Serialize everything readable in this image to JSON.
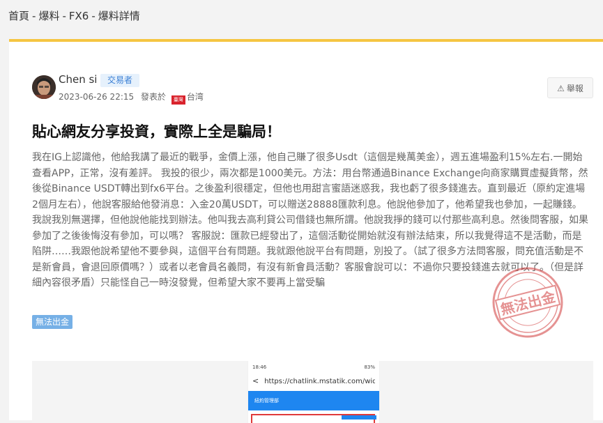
{
  "breadcrumb": {
    "items": [
      "首頁",
      "爆料",
      "FX6",
      "爆料詳情"
    ],
    "separator": "-"
  },
  "post": {
    "author": "Chen si",
    "role": "交易者",
    "datetime": "2023-06-26 22:15",
    "posted_in_label": "發表於",
    "flag_text": "臺灣",
    "region": "台湾",
    "report_label": "舉報",
    "title": "貼心網友分享投資，實際上全是騙局！",
    "body": "我在IG上認識他，他給我講了最近的戰爭，金價上漲，他自己賺了很多Usdt（這個是幾萬美金），週五進場盈利15%左右.一開始查看APP，正常，沒有差評。 我投的很少，兩次都是1000美元。方法：用台幣通過Binance Exchange向商家購買虛擬貨幣，然後從Binance USDT轉出到fx6平台。之後盈利很穩定，但他也用甜言蜜語迷惑我，我也虧了很多錢進去。直到最近（原約定進場2個月左右），他說客服給他發消息：入金20萬USDT，可以贈送28888匯款利息。他說他參加了，他希望我也參加，一起賺錢。 我說我別無選擇，但他說他能找到辦法。他叫我去高利貸公司借錢也無所謂。他說我掙的錢可以付那些高利息。然後問客服，如果參加了之後後悔沒有參加，可以嗎？ 客服說：匯款已經發出了，這個活動從開始就沒有辦法結束，所以我覺得這不是活動，而是陷阱……我跟他說希望他不要參與，這個平台有問題。我就跟他說平台有問題，別投了。（試了很多方法問客服，問充值活動是不是新會員，會退回原價嗎？）或者以老會員名義問，有沒有新會員活動？客服會說可以：不過你只要投錢進去就可以了。（但是詳細內容很矛盾）只能怪自己一時沒發覺，但希望大家不要再上當受騙",
    "tag": "無法出金",
    "stamp_text": "無法出金"
  },
  "screenshot": {
    "time": "18:46",
    "battery": "83%",
    "url": "https://chatlink.mstatik.com/widg...",
    "header": "紐約管理部"
  },
  "colors": {
    "accent_bar": "#f5c542",
    "badge_bg": "#e6f1fc",
    "badge_text": "#3a7fd5",
    "tag_bg": "#76b0e6",
    "stamp": "#d13a3a",
    "flag": "#d9232d"
  },
  "icons": {
    "report": "warning-triangle-icon",
    "back": "chevron-left-icon"
  }
}
